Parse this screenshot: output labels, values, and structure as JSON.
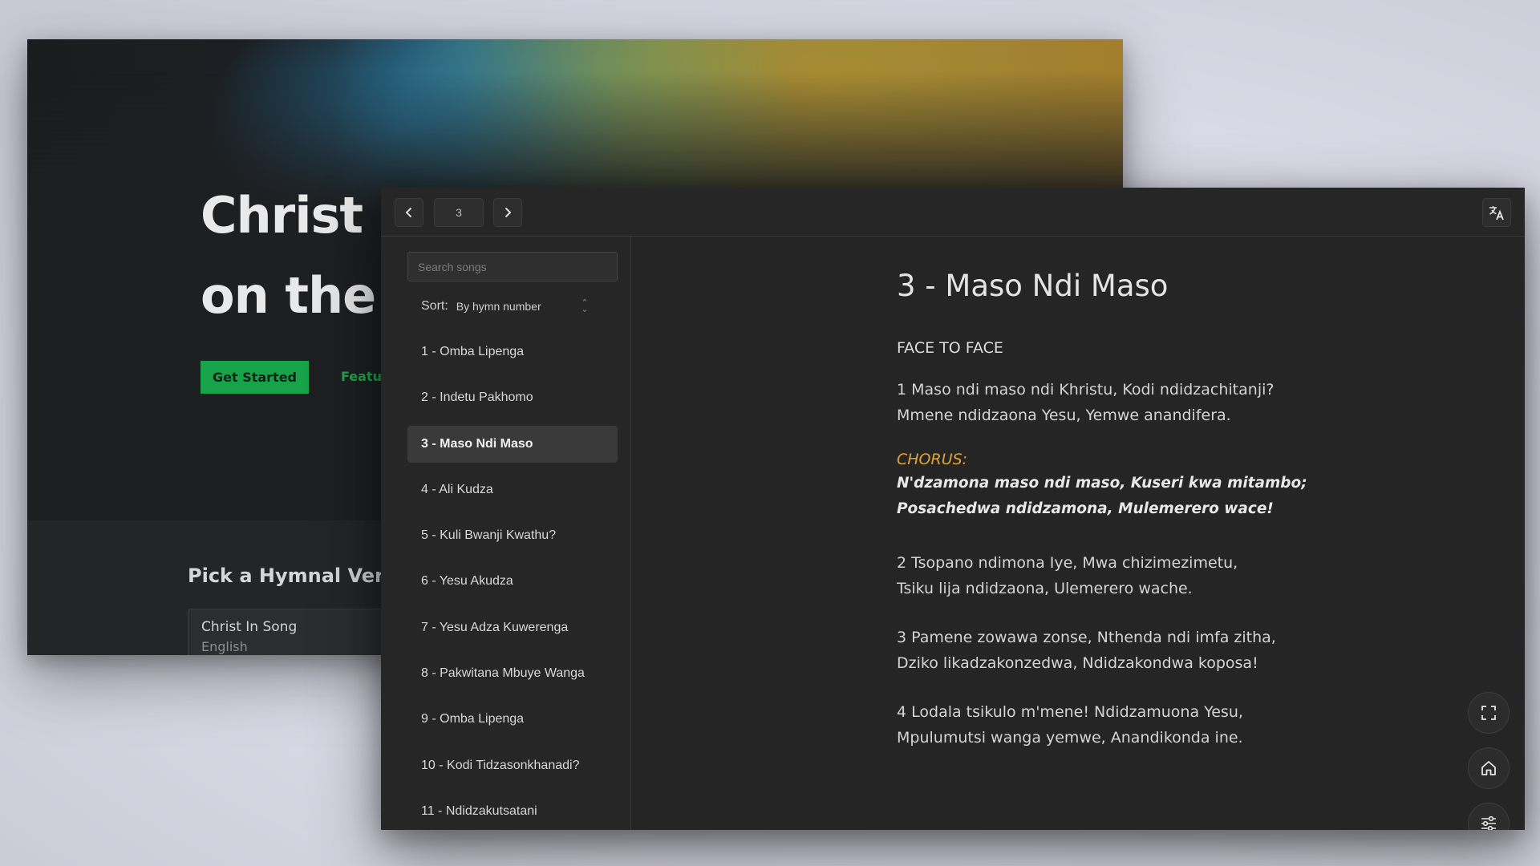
{
  "background_site": {
    "hero_title_line1": "Christ i",
    "hero_title_line2": "on the",
    "get_started_label": "Get Started",
    "features_label": "Featur",
    "pick_title": "Pick a Hymnal Versi",
    "hymnal_card": {
      "name": "Christ In Song",
      "language": "English"
    },
    "accent_color": "#17a34a"
  },
  "app": {
    "topbar": {
      "prev_icon": "chevron-left-icon",
      "song_number": "3",
      "next_icon": "chevron-right-icon",
      "translate_icon": "translate-icon"
    },
    "sidebar": {
      "search_placeholder": "Search songs",
      "sort_label": "Sort:",
      "sort_value": "By hymn number",
      "songs": [
        "1 - Omba Lipenga",
        "2 - Indetu Pakhomo",
        "3 - Maso Ndi Maso",
        "4 - Ali Kudza",
        "5 - Kuli Bwanji Kwathu?",
        "6 - Yesu Akudza",
        "7 - Yesu Adza Kuwerenga",
        "8 - Pakwitana Mbuye Wanga",
        "9 - Omba Lipenga",
        "10 - Kodi Tidzasonkhanadi?",
        "11 - Ndidzakutsatani"
      ],
      "active_index": 2
    },
    "song": {
      "title": "3 - Maso Ndi Maso",
      "subtitle": "FACE TO FACE",
      "verse1": [
        "1 Maso ndi maso ndi Khristu, Kodi ndidzachitanji?",
        "Mmene ndidzaona Yesu, Yemwe anandifera."
      ],
      "chorus_label": "CHORUS:",
      "chorus": [
        "N'dzamona maso ndi maso, Kuseri kwa mitambo;",
        "Posachedwa ndidzamona, Mulemerero wace!"
      ],
      "verse2": [
        "2 Tsopano ndimona Iye, Mwa chizimezimetu,",
        "Tsiku lija ndidzaona, Ulemerero wache."
      ],
      "verse3": [
        "3 Pamene zowawa zonse, Nthenda ndi imfa zitha,",
        "Dziko likadzakonzedwa, Ndidzakondwa koposa!"
      ],
      "verse4": [
        "4 Lodala tsikulo m'mene! Ndidzamuona Yesu,",
        "Mpulumutsi wanga yemwe, Anandikonda ine."
      ],
      "chorus_color": "#e0a23a"
    },
    "floating_buttons": [
      "fullscreen-icon",
      "home-icon",
      "settings-sliders-icon"
    ]
  }
}
